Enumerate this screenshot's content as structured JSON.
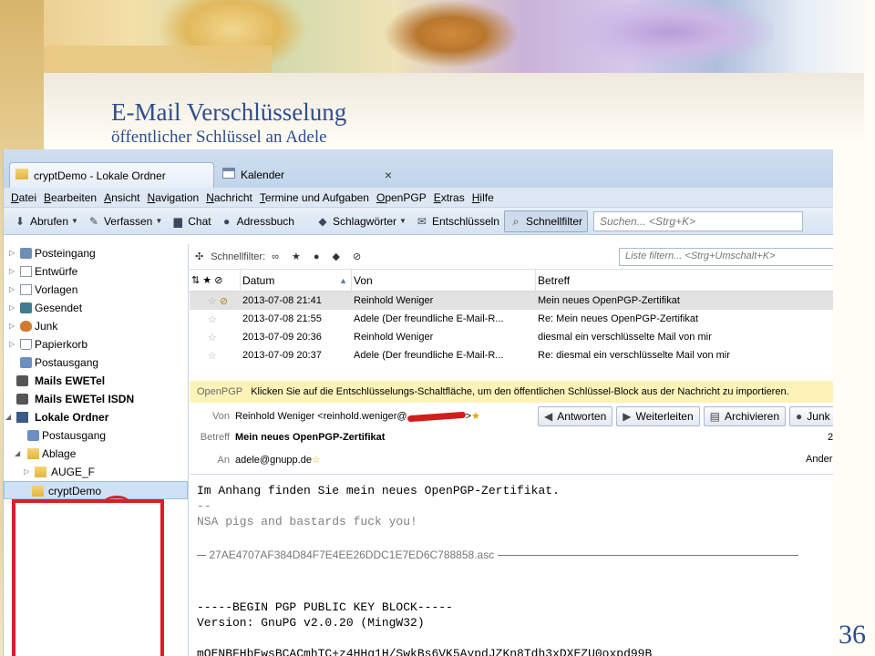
{
  "slide": {
    "title": "E-Mail Verschlüsselung",
    "subtitle": "öffentlicher Schlüssel an Adele",
    "page_number": "36"
  },
  "tabs": [
    {
      "label": "cryptDemo - Lokale Ordner",
      "icon": "folder-icon"
    },
    {
      "label": "Kalender",
      "icon": "calendar-icon"
    }
  ],
  "tab_close": "×",
  "menu": [
    "Datei",
    "Bearbeiten",
    "Ansicht",
    "Navigation",
    "Nachricht",
    "Termine und Aufgaben",
    "OpenPGP",
    "Extras",
    "Hilfe"
  ],
  "toolbar": {
    "get_mail": "Abrufen",
    "write": "Verfassen",
    "chat": "Chat",
    "address_book": "Adressbuch",
    "tags": "Schlagwörter",
    "decrypt": "Entschlüsseln",
    "quick_filter": "Schnellfilter",
    "search_placeholder": "Suchen... <Strg+K>"
  },
  "folders": [
    {
      "label": "Posteingang",
      "icon": "inbox"
    },
    {
      "label": "Entwürfe",
      "icon": "draft"
    },
    {
      "label": "Vorlagen",
      "icon": "draft"
    },
    {
      "label": "Gesendet",
      "icon": "sent"
    },
    {
      "label": "Junk",
      "icon": "junk"
    },
    {
      "label": "Papierkorb",
      "icon": "trash"
    },
    {
      "label": "Postausgang",
      "icon": "outbox"
    },
    {
      "label": "Mails EWETel",
      "icon": "acct"
    },
    {
      "label": "Mails EWETel ISDN",
      "icon": "acct"
    },
    {
      "label": "Lokale Ordner",
      "icon": "comp"
    },
    {
      "label": "Postausgang",
      "icon": "outbox"
    },
    {
      "label": "Ablage",
      "icon": "fold"
    },
    {
      "label": "AUGE_F",
      "icon": "fold"
    },
    {
      "label": "cryptDemo",
      "icon": "fold"
    }
  ],
  "quickfilter": {
    "label": "Schnellfilter:",
    "filter_placeholder": "Liste filtern... <Strg+Umschalt+K>"
  },
  "thread_columns": {
    "date": "Datum",
    "from": "Von",
    "subject": "Betreff"
  },
  "messages": [
    {
      "date": "2013-07-08 21:41",
      "from": "Reinhold Weniger",
      "subject": "Mein neues OpenPGP-Zertifikat"
    },
    {
      "date": "2013-07-08 21:55",
      "from": "Adele (Der freundliche E-Mail-R...",
      "subject": "Re: Mein neues OpenPGP-Zertifikat"
    },
    {
      "date": "2013-07-09 20:36",
      "from": "Reinhold Weniger",
      "subject": "diesmal ein verschlüsselte Mail von mir"
    },
    {
      "date": "2013-07-09 20:37",
      "from": "Adele (Der freundliche E-Mail-R...",
      "subject": "Re: diesmal ein verschlüsselte Mail von mir"
    }
  ],
  "pgp_notice": {
    "label": "OpenPGP",
    "text": "Klicken Sie auf die Entschlüsselungs-Schaltfläche, um den öffentlichen Schlüssel-Block aus der Nachricht zu importieren."
  },
  "header": {
    "from_label": "Von",
    "from_value": "Reinhold Weniger <reinhold.weniger@",
    "from_tail": ">",
    "subject_label": "Betreff",
    "subject_value": "Mein neues OpenPGP-Zertifikat",
    "subject_right": "2",
    "to_label": "An",
    "to_value": "adele@gnupp.de",
    "to_right": "Ander",
    "reply": "Antworten",
    "forward": "Weiterleiten",
    "archive": "Archivieren",
    "junk": "Junk"
  },
  "body": {
    "line1": "Im Anhang finden Sie mein neues OpenPGP-Zertifikat.",
    "sig_sep": "--",
    "sig_text": "NSA pigs and bastards fuck you!",
    "attachment": "27AE4707AF384D84F7E4EE26DDC1E7ED6C788858.asc",
    "key_begin": "-----BEGIN PGP PUBLIC KEY BLOCK-----",
    "key_version": "Version: GnuPG v2.0.20 (MingW32)",
    "key_data": "mQENBFHbEwsBCACmhTC+z4HHg1H/SwkBs6VK5AypdJZKn8Tdh3xDXEZU0oxpd99B"
  }
}
